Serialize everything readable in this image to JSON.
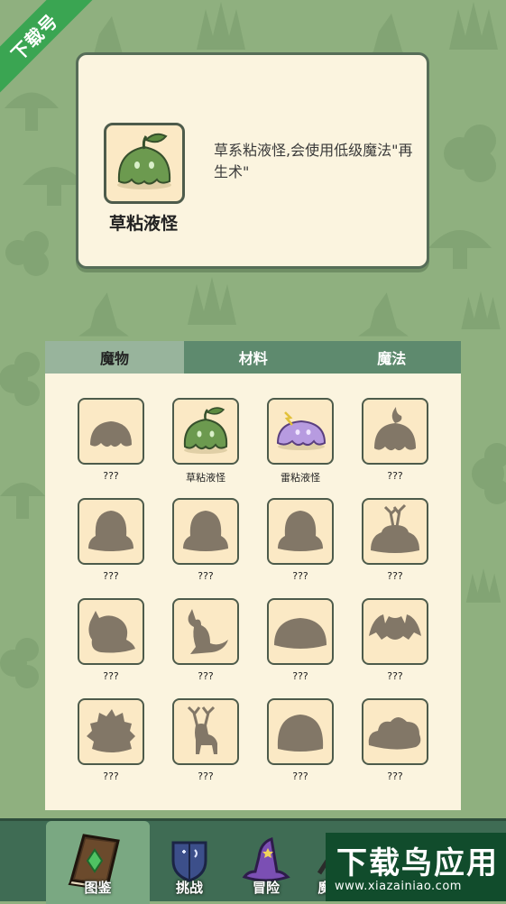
{
  "ribbon_text": "下载号",
  "info": {
    "name": "草粘液怪",
    "description": "草系粘液怪,会使用低级魔法\"再生术\""
  },
  "tabs": [
    {
      "label": "魔物",
      "active": true
    },
    {
      "label": "材料",
      "active": false
    },
    {
      "label": "魔法",
      "active": false
    }
  ],
  "entries": [
    {
      "label": "???",
      "icon": "slime-silhouette-icon"
    },
    {
      "label": "草粘液怪",
      "icon": "grass-slime-icon"
    },
    {
      "label": "雷粘液怪",
      "icon": "thunder-slime-icon"
    },
    {
      "label": "???",
      "icon": "flame-slime-silhouette-icon"
    },
    {
      "label": "???",
      "icon": "blob-silhouette-icon"
    },
    {
      "label": "???",
      "icon": "blob-silhouette-icon"
    },
    {
      "label": "???",
      "icon": "blob-silhouette-icon"
    },
    {
      "label": "???",
      "icon": "tree-stump-silhouette-icon"
    },
    {
      "label": "???",
      "icon": "beast-silhouette-icon"
    },
    {
      "label": "???",
      "icon": "kangaroo-silhouette-icon"
    },
    {
      "label": "???",
      "icon": "mound-silhouette-icon"
    },
    {
      "label": "???",
      "icon": "bat-silhouette-icon"
    },
    {
      "label": "???",
      "icon": "hedgehog-silhouette-icon"
    },
    {
      "label": "???",
      "icon": "deer-silhouette-icon"
    },
    {
      "label": "???",
      "icon": "mound-silhouette-icon"
    },
    {
      "label": "???",
      "icon": "cloud-silhouette-icon"
    }
  ],
  "nav": [
    {
      "label": "图鉴",
      "icon": "book-icon",
      "active": true
    },
    {
      "label": "挑战",
      "icon": "shield-icon",
      "active": false
    },
    {
      "label": "冒险",
      "icon": "wizard-hat-icon",
      "active": false
    },
    {
      "label": "魔",
      "icon": "magic-icon",
      "active": false
    }
  ],
  "watermark": {
    "title": "下载鸟应用",
    "url": "www.xiazainiao.com"
  },
  "colors": {
    "background": "#8fb07f",
    "card": "#fbf4df",
    "tab_bar": "#5e8a6e",
    "nav_bar": "#3f6c54",
    "silhouette": "#827767"
  }
}
